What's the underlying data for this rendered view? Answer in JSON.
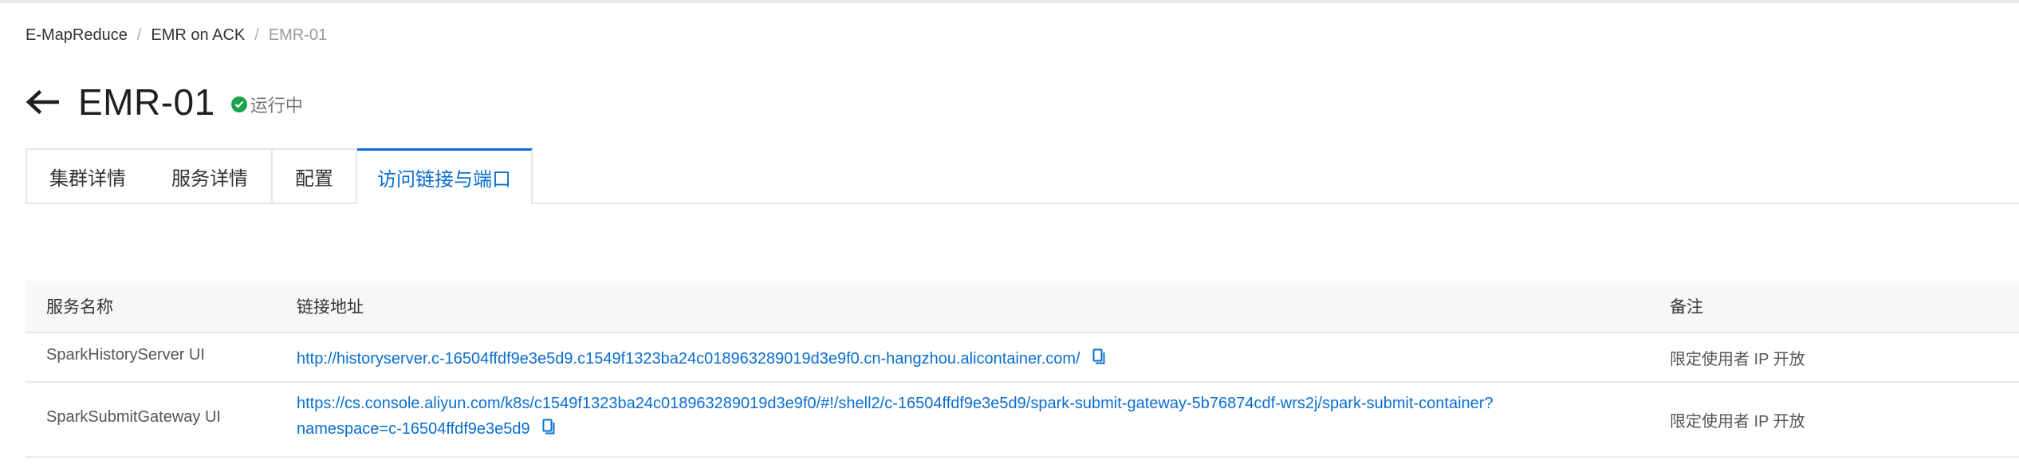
{
  "breadcrumb": {
    "items": [
      "E-MapReduce",
      "EMR on ACK",
      "EMR-01"
    ],
    "separator": "/"
  },
  "header": {
    "title": "EMR-01",
    "status": "运行中",
    "status_color": "#1aa34a",
    "back_icon": "arrow-left-icon"
  },
  "tabs": [
    {
      "label": "集群详情",
      "active": false
    },
    {
      "label": "服务详情",
      "active": false
    },
    {
      "label": "配置",
      "active": false
    },
    {
      "label": "访问链接与端口",
      "active": true
    }
  ],
  "table": {
    "columns": [
      "服务名称",
      "链接地址",
      "备注"
    ],
    "rows": [
      {
        "name": "SparkHistoryServer UI",
        "link": "http://historyserver.c-16504ffdf9e3e5d9.c1549f1323ba24c018963289019d3e9f0.cn-hangzhou.alicontainer.com/",
        "note": "限定使用者 IP 开放"
      },
      {
        "name": "SparkSubmitGateway UI",
        "link_line1": "https://cs.console.aliyun.com/k8s/c1549f1323ba24c018963289019d3e9f0/#!/shell2/c-16504ffdf9e3e5d9/spark-submit-gateway-5b76874cdf-wrs2j/spark-submit-container?",
        "link_line2": "namespace=c-16504ffdf9e3e5d9",
        "note": "限定使用者 IP 开放"
      }
    ]
  },
  "colors": {
    "accent": "#0a6ed1",
    "success": "#1aa34a"
  },
  "icons": [
    "arrow-left-icon",
    "check-circle-icon",
    "copy-icon"
  ]
}
